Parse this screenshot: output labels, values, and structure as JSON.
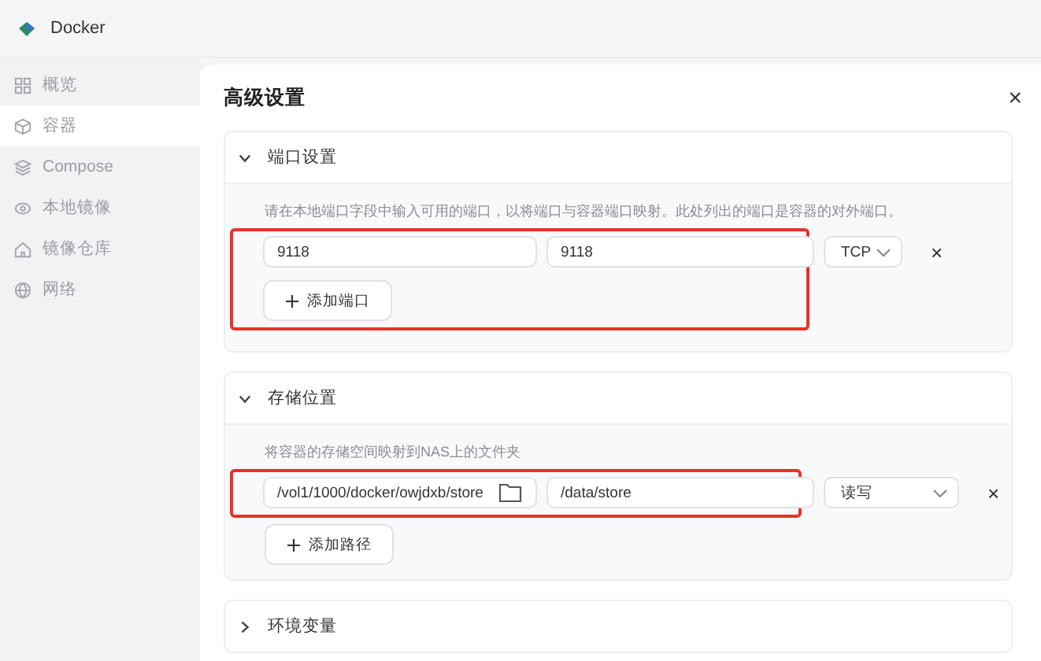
{
  "app": {
    "title": "Docker"
  },
  "sidebar": {
    "items": [
      {
        "label": "概览",
        "selected": false
      },
      {
        "label": "容器",
        "selected": true
      },
      {
        "label": "Compose",
        "selected": false
      },
      {
        "label": "本地镜像",
        "selected": false
      },
      {
        "label": "镜像仓库",
        "selected": false
      },
      {
        "label": "网络",
        "selected": false
      }
    ]
  },
  "dialog": {
    "title": "高级设置",
    "close": "×",
    "sections": [
      {
        "kind": "ports",
        "title": "端口设置",
        "expanded": true,
        "highlighted": true,
        "description": "请在本地端口字段中输入可用的端口，以将端口与容器端口映射。此处列出的端口是容器的对外端口。",
        "rows": [
          {
            "local": "9118",
            "container": "9118",
            "option": "TCP",
            "remove": "×"
          }
        ],
        "add_button": "添加端口"
      },
      {
        "kind": "storage",
        "title": "存储位置",
        "expanded": true,
        "highlighted": true,
        "description": "将容器的存储空间映射到NAS上的文件夹",
        "rows": [
          {
            "local": "/vol1/1000/docker/owjdxb/store",
            "container": "/data/store",
            "option": "读写",
            "remove": "×"
          }
        ],
        "add_button": "添加路径"
      },
      {
        "kind": "env",
        "title": "环境变量",
        "expanded": false
      }
    ]
  }
}
